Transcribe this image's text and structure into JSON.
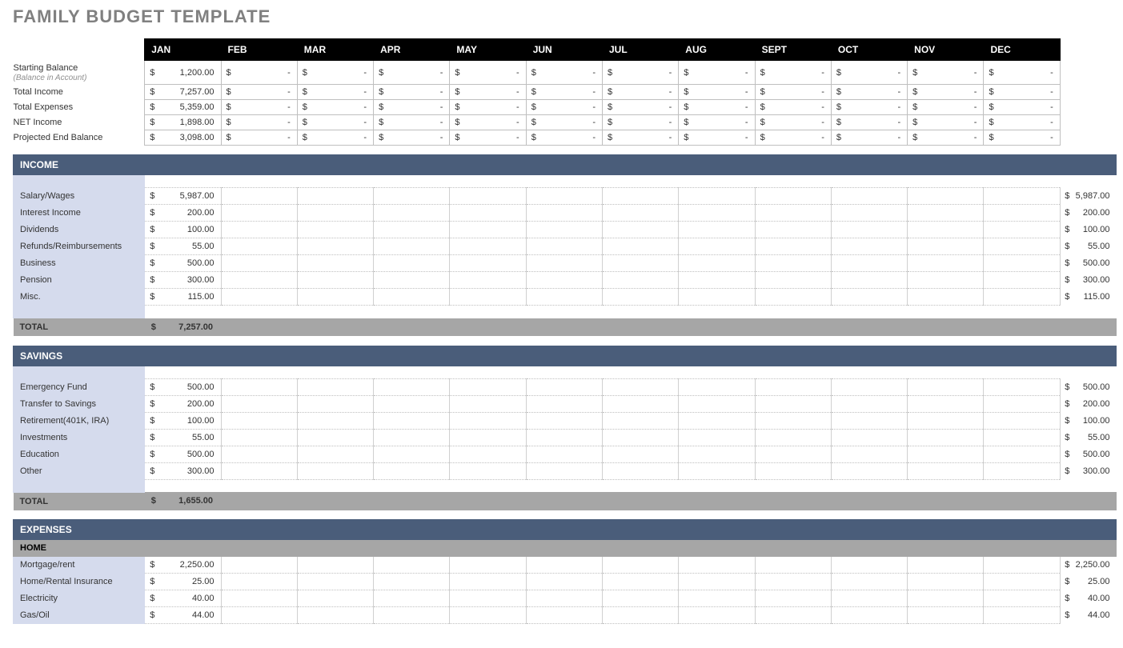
{
  "title": "FAMILY BUDGET TEMPLATE",
  "months": [
    "JAN",
    "FEB",
    "MAR",
    "APR",
    "MAY",
    "JUN",
    "JUL",
    "AUG",
    "SEPT",
    "OCT",
    "NOV",
    "DEC"
  ],
  "summary": {
    "starting_label": "Starting Balance",
    "starting_sub": "(Balance in Account)",
    "starting_jan": "1,200.00",
    "total_income_label": "Total Income",
    "total_income_jan": "7,257.00",
    "total_expenses_label": "Total Expenses",
    "total_expenses_jan": "5,359.00",
    "net_income_label": "NET Income",
    "net_income_jan": "1,898.00",
    "proj_end_label": "Projected End Balance",
    "proj_end_jan": "3,098.00"
  },
  "income": {
    "header": "INCOME",
    "rows": [
      {
        "label": "Salary/Wages",
        "jan": "5,987.00",
        "total": "5,987.00"
      },
      {
        "label": "Interest Income",
        "jan": "200.00",
        "total": "200.00"
      },
      {
        "label": "Dividends",
        "jan": "100.00",
        "total": "100.00"
      },
      {
        "label": "Refunds/Reimbursements",
        "jan": "55.00",
        "total": "55.00"
      },
      {
        "label": "Business",
        "jan": "500.00",
        "total": "500.00"
      },
      {
        "label": "Pension",
        "jan": "300.00",
        "total": "300.00"
      },
      {
        "label": "Misc.",
        "jan": "115.00",
        "total": "115.00"
      }
    ],
    "total_label": "TOTAL",
    "total_jan": "7,257.00"
  },
  "savings": {
    "header": "SAVINGS",
    "rows": [
      {
        "label": "Emergency Fund",
        "jan": "500.00",
        "total": "500.00"
      },
      {
        "label": "Transfer to Savings",
        "jan": "200.00",
        "total": "200.00"
      },
      {
        "label": "Retirement(401K, IRA)",
        "jan": "100.00",
        "total": "100.00"
      },
      {
        "label": "Investments",
        "jan": "55.00",
        "total": "55.00"
      },
      {
        "label": "Education",
        "jan": "500.00",
        "total": "500.00"
      },
      {
        "label": "Other",
        "jan": "300.00",
        "total": "300.00"
      }
    ],
    "total_label": "TOTAL",
    "total_jan": "1,655.00"
  },
  "expenses": {
    "header": "EXPENSES",
    "home_sub": "HOME",
    "rows": [
      {
        "label": "Mortgage/rent",
        "jan": "2,250.00",
        "total": "2,250.00"
      },
      {
        "label": "Home/Rental Insurance",
        "jan": "25.00",
        "total": "25.00"
      },
      {
        "label": "Electricity",
        "jan": "40.00",
        "total": "40.00"
      },
      {
        "label": "Gas/Oil",
        "jan": "44.00",
        "total": "44.00"
      }
    ]
  },
  "currency": "$",
  "dash": "-"
}
